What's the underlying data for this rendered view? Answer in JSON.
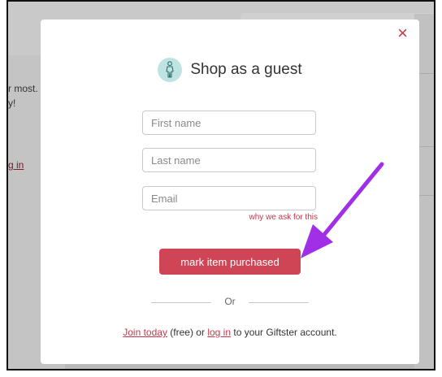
{
  "background": {
    "text_line1": "r most.",
    "text_line2": "y!",
    "link_fragment": "g in"
  },
  "modal": {
    "close_icon": "×",
    "avatar_icon": "walking-person-icon",
    "title": "Shop as a guest",
    "first_name_placeholder": "First name",
    "last_name_placeholder": "Last name",
    "email_placeholder": "Email",
    "why_link": "why we ask for this",
    "submit_label": "mark item purchased",
    "or_label": "Or",
    "footer": {
      "join_link": "Join today",
      "free": "(free) or",
      "login_link": "log in",
      "rest": "to your Giftster account."
    }
  },
  "annotation": {
    "arrow_color": "#a12fe8"
  },
  "colors": {
    "accent": "#cf4556",
    "link": "#c23a4c",
    "avatar_bg": "#bfe2e2"
  }
}
